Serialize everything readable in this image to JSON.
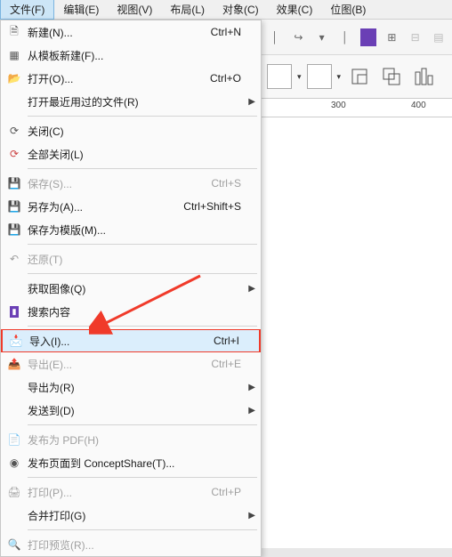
{
  "menubar": [
    {
      "label": "文件(F)",
      "active": true
    },
    {
      "label": "编辑(E)"
    },
    {
      "label": "视图(V)"
    },
    {
      "label": "布局(L)"
    },
    {
      "label": "对象(C)"
    },
    {
      "label": "效果(C)"
    },
    {
      "label": "位图(B)"
    }
  ],
  "ruler": {
    "t300": "300",
    "t400": "400"
  },
  "menu": {
    "new": "新建(N)...",
    "new_sc": "Ctrl+N",
    "new_tpl": "从模板新建(F)...",
    "open": "打开(O)...",
    "open_sc": "Ctrl+O",
    "recent": "打开最近用过的文件(R)",
    "close": "关闭(C)",
    "close_all": "全部关闭(L)",
    "save": "保存(S)...",
    "save_sc": "Ctrl+S",
    "save_as": "另存为(A)...",
    "save_as_sc": "Ctrl+Shift+S",
    "save_tpl": "保存为模版(M)...",
    "revert": "还原(T)",
    "acquire": "获取图像(Q)",
    "search": "搜索内容",
    "import": "导入(I)...",
    "import_sc": "Ctrl+I",
    "export": "导出(E)...",
    "export_sc": "Ctrl+E",
    "export_for": "导出为(R)",
    "send_to": "发送到(D)",
    "pub_pdf": "发布为 PDF(H)",
    "pub_cs": "发布页面到 ConceptShare(T)...",
    "print": "打印(P)...",
    "print_sc": "Ctrl+P",
    "print_merge": "合并打印(G)",
    "print_preview": "打印预览(R)..."
  }
}
